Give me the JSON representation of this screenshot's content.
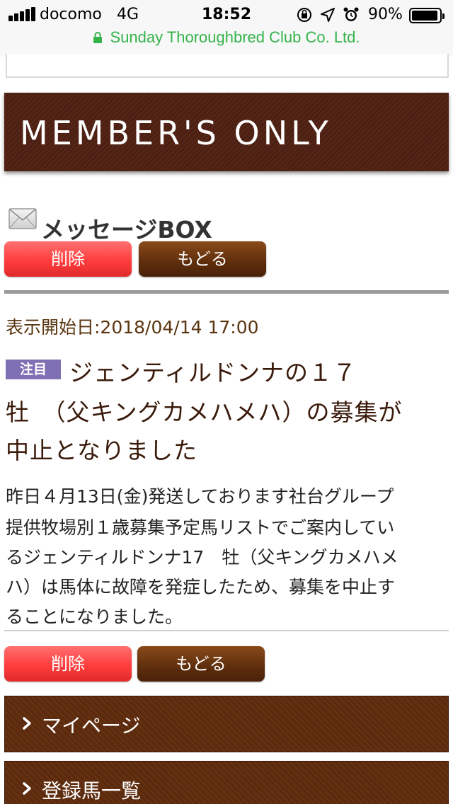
{
  "status_bar": {
    "carrier": "docomo",
    "network": "4G",
    "time": "18:52",
    "battery_percent": "90%",
    "url": "Sunday Thoroughbred Club Co. Ltd.",
    "url_color": "#33b34a",
    "icons": [
      "signal-icon",
      "orientation-lock-icon",
      "location-icon",
      "alarm-icon",
      "battery-icon",
      "lock-icon"
    ]
  },
  "banner": {
    "title": "MEMBER'S ONLY"
  },
  "message_box": {
    "title": "メッセージBOX",
    "delete_label": "削除",
    "back_label": "もどる"
  },
  "message": {
    "display_date": "表示開始日:2018/04/14 17:00",
    "tag": "注目",
    "title_lines": [
      "ジェンティルドンナの１７",
      "牡　（父キングカメハメハ）の募集が",
      "中止となりました"
    ],
    "body_lines": [
      "昨日４月13日(金)発送しております社台グループ",
      "提供牧場別１歳募集予定馬リストでご案内してい",
      "るジェンティルドンナ17　牡（父キングカメハメ",
      "ハ）は馬体に故障を発症したため、募集を中止す",
      "ることになりました。"
    ]
  },
  "footer_buttons": {
    "delete_label": "削除",
    "back_label": "もどる"
  },
  "nav": {
    "items": [
      {
        "label": "マイページ"
      },
      {
        "label": "登録馬一覧"
      }
    ]
  },
  "colors": {
    "delete_button": "#ff4040",
    "back_button": "#5e2e0c",
    "tag": "#7f70b5",
    "banner": "#4e2114"
  }
}
